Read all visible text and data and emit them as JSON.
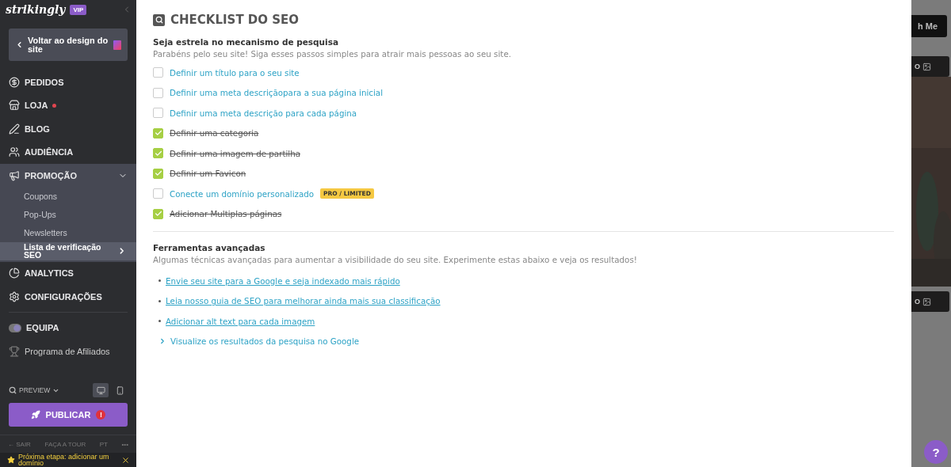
{
  "sidebar": {
    "logo": "strikingly",
    "badge": "VIP",
    "back_button": "Voltar ao design do site",
    "nav": [
      {
        "kind": "main",
        "label": "PEDIDOS",
        "dot": false
      },
      {
        "kind": "main",
        "label": "LOJA",
        "dot": true
      },
      {
        "kind": "main",
        "label": "BLOG",
        "dot": false
      },
      {
        "kind": "main",
        "label": "AUDIÊNCIA",
        "dot": false
      },
      {
        "kind": "main",
        "label": "PROMOÇÃO",
        "dot": false,
        "expanded": true,
        "children": [
          {
            "label": "Coupons",
            "selected": false
          },
          {
            "label": "Pop-Ups",
            "selected": false
          },
          {
            "label": "Newsletters",
            "selected": false
          },
          {
            "label": "Lista de verificação SEO",
            "selected": true
          }
        ]
      },
      {
        "kind": "main",
        "label": "ANALYTICS",
        "dot": false
      },
      {
        "kind": "main",
        "label": "CONFIGURAÇÕES",
        "dot": false
      },
      {
        "kind": "divider"
      },
      {
        "kind": "main",
        "label": "EQUIPA",
        "dot": false
      },
      {
        "kind": "plain",
        "label": "Programa de Afiliados",
        "dot": false
      }
    ],
    "preview": "PREVIEW",
    "devices": [
      {
        "kind": "desktop",
        "selected": true
      },
      {
        "kind": "mobile",
        "selected": false
      }
    ],
    "publish": "PUBLICAR",
    "publish_alert": "!",
    "footer": [
      "← SAIR",
      "FAÇA A TOUR",
      "PT",
      "•••"
    ],
    "next_step": "Próxima etapa: adicionar um domínio"
  },
  "checklist": {
    "title": "CHECKLIST DO SEO",
    "subtitle": "Seja estrela no mecanismo de pesquisa",
    "intro": "Parabéns pelo seu site! Siga esses passos simples para atrair mais pessoas ao seu site.",
    "items": [
      {
        "label": "Definir um título para o seu site",
        "checked": false
      },
      {
        "label": "Definir uma meta descriçãopara a sua página inicial",
        "checked": false
      },
      {
        "label": "Definir uma meta descrição para cada página",
        "checked": false
      },
      {
        "label": "Definir uma categoria",
        "checked": true
      },
      {
        "label": "Definir uma imagem de partilha",
        "checked": true
      },
      {
        "label": "Definir um Favicon",
        "checked": true
      },
      {
        "label": "Conecte um domínio personalizado",
        "checked": false,
        "badge": "PRO / LIMITED"
      },
      {
        "label": "Adicionar Multiplas páginas",
        "checked": true
      }
    ]
  },
  "tools": {
    "title": "Ferramentas avançadas",
    "intro": "Algumas técnicas avançadas para aumentar a visibilidade do seu site. Experimente estas abaixo e veja os resultados!",
    "links": [
      "Envie seu site para a Google e seja indexado mais rápido",
      "Leia nosso guia de SEO para melhorar ainda mais sua classificação",
      "Adicionar alt text para cada imagem"
    ],
    "preview_toggle": {
      "label": "Visualize os resultados da pesquisa no Google",
      "expanded": false
    }
  },
  "background_site": {
    "button": "h Me",
    "tags": [
      "O",
      "O"
    ],
    "help": "?"
  }
}
